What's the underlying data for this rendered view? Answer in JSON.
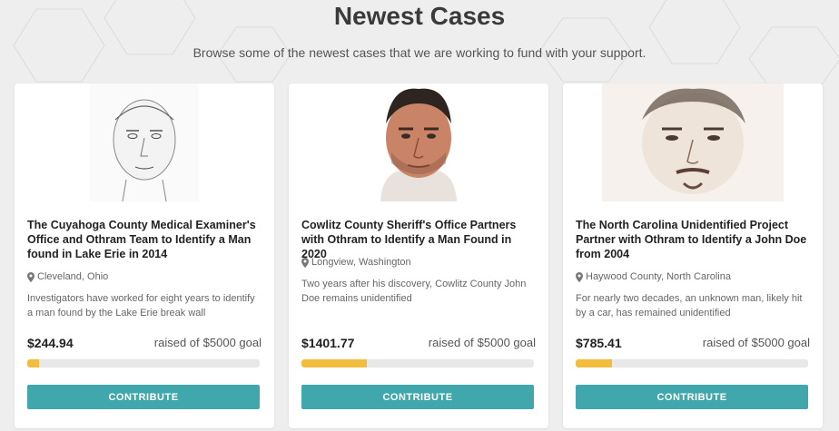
{
  "header": {
    "title": "Newest Cases",
    "subtitle": "Browse some of the newest cases that we are working to fund with your support."
  },
  "colors": {
    "accent": "#40a7ad",
    "progress": "#f2bc3c",
    "track": "#e8e8e8"
  },
  "cards": [
    {
      "title": "The Cuyahoga County Medical Examiner's Office and Othram Team to Identify a Man found in Lake Erie in 2014",
      "location": "Cleveland, Ohio",
      "description": "Investigators have worked for eight years to identify a man found by the Lake Erie break wall",
      "raised": "$244.94",
      "goal_prefix": "raised of",
      "goal": "$5000 goal",
      "progress_fraction": 0.049,
      "button": "CONTRIBUTE",
      "portrait_icon": "sketch-portrait-icon"
    },
    {
      "title": "Cowlitz County Sheriff's Office Partners with Othram to Identify a Man Found in 2020",
      "location": "Longview, Washington",
      "description": "Two years after his discovery, Cowlitz County John Doe remains unidentified",
      "raised": "$1401.77",
      "goal_prefix": "raised of",
      "goal": "$5000 goal",
      "progress_fraction": 0.28,
      "button": "CONTRIBUTE",
      "portrait_icon": "color-reconstruction-portrait-icon"
    },
    {
      "title": "The North Carolina Unidentified Project Partner with Othram to Identify a John Doe from 2004",
      "location": "Haywood County, North Carolina",
      "description": "For nearly two decades, an unknown man, likely hit by a car, has remained unidentified",
      "raised": "$785.41",
      "goal_prefix": "raised of",
      "goal": "$5000 goal",
      "progress_fraction": 0.157,
      "button": "CONTRIBUTE",
      "portrait_icon": "sketch-portrait-icon"
    }
  ]
}
